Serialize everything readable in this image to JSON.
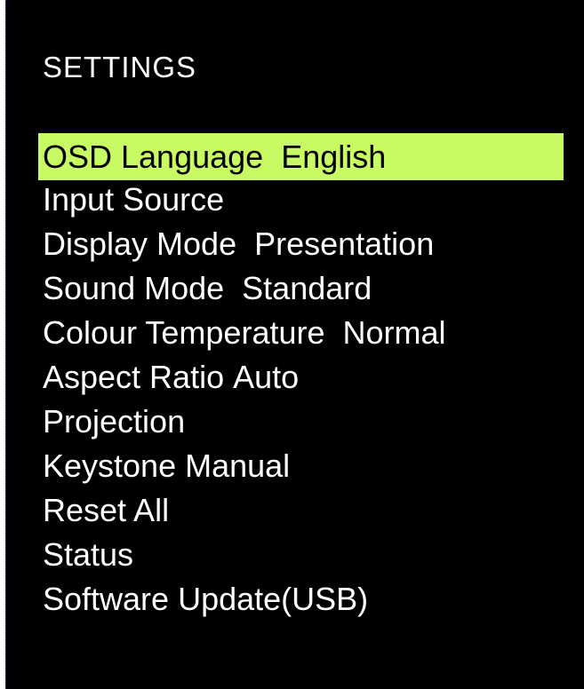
{
  "title": "SETTINGS",
  "colors": {
    "background": "#000000",
    "text": "#ffffff",
    "highlight": "#c8fa64",
    "highlight_text": "#000000"
  },
  "menu": {
    "selected_index": 0,
    "items": [
      {
        "label": "OSD Language",
        "value": "English"
      },
      {
        "label": "Input Source",
        "value": ""
      },
      {
        "label": "Display Mode",
        "value": "Presentation"
      },
      {
        "label": "Sound Mode",
        "value": "Standard"
      },
      {
        "label": "Colour Temperature",
        "value": "Normal"
      },
      {
        "label": "Aspect Ratio",
        "value": "Auto"
      },
      {
        "label": "Projection",
        "value": ""
      },
      {
        "label": "Keystone",
        "value": "Manual"
      },
      {
        "label": "Reset All",
        "value": ""
      },
      {
        "label": "Status",
        "value": ""
      },
      {
        "label": "Software Update(USB)",
        "value": ""
      }
    ]
  }
}
